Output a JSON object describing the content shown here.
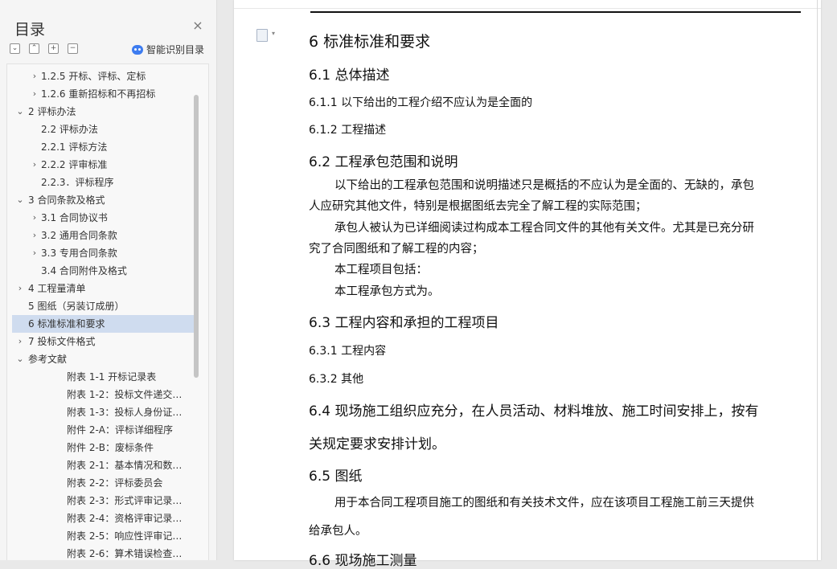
{
  "toc": {
    "title": "目录",
    "close_symbol": "×",
    "tools": [
      "⌄",
      "⌃",
      "+",
      "−"
    ],
    "ai_label": "智能识别目录",
    "items": [
      {
        "label": "1.2.5 开标、评标、定标",
        "chev": "›",
        "level": 1
      },
      {
        "label": "1.2.6 重新招标和不再招标",
        "chev": "›",
        "level": 1
      },
      {
        "label": "2 评标办法",
        "chev": "⌄",
        "level": 0
      },
      {
        "label": "2.2 评标办法",
        "chev": "",
        "level": 1
      },
      {
        "label": "2.2.1 评标方法",
        "chev": "",
        "level": 1
      },
      {
        "label": "2.2.2 评审标准",
        "chev": "›",
        "level": 1
      },
      {
        "label": "2.2.3．评标程序",
        "chev": "",
        "level": 1
      },
      {
        "label": "3 合同条款及格式",
        "chev": "⌄",
        "level": 0
      },
      {
        "label": "3.1  合同协议书",
        "chev": "›",
        "level": 1
      },
      {
        "label": "3.2  通用合同条款",
        "chev": "›",
        "level": 1
      },
      {
        "label": "3.3  专用合同条款",
        "chev": "›",
        "level": 1
      },
      {
        "label": "3.4  合同附件及格式",
        "chev": "",
        "level": 1
      },
      {
        "label": "4 工程量清单",
        "chev": "›",
        "level": 0
      },
      {
        "label": "5 图纸（另装订成册）",
        "chev": "",
        "level": 0
      },
      {
        "label": "6  标准标准和要求",
        "chev": "",
        "level": 0,
        "selected": true
      },
      {
        "label": "7 投标文件格式",
        "chev": "›",
        "level": 0
      },
      {
        "label": "参考文献",
        "chev": "⌄",
        "level": 0
      },
      {
        "label": "附表 1-1  开标记录表",
        "chev": "",
        "level": 2
      },
      {
        "label": "附表 1-2：投标文件递交…",
        "chev": "",
        "level": 2
      },
      {
        "label": "附表 1-3：投标人身份证…",
        "chev": "",
        "level": 2
      },
      {
        "label": "附件 2-A：评标详细程序",
        "chev": "",
        "level": 2
      },
      {
        "label": "附件 2-B：废标条件",
        "chev": "",
        "level": 2
      },
      {
        "label": "附表 2-1：基本情况和数…",
        "chev": "",
        "level": 2
      },
      {
        "label": "附表 2-2：评标委员会",
        "chev": "",
        "level": 2
      },
      {
        "label": "附表 2-3：形式评审记录…",
        "chev": "",
        "level": 2
      },
      {
        "label": "附表 2-4：资格评审记录…",
        "chev": "",
        "level": 2
      },
      {
        "label": "附表 2-5：响应性评审记…",
        "chev": "",
        "level": 2
      },
      {
        "label": "附表 2-6：算术错误检查…",
        "chev": "",
        "level": 2
      }
    ]
  },
  "doc": {
    "h_6": "6  标准标准和要求",
    "h_6_1": "6.1 总体描述",
    "h_6_1_1": "6.1.1 以下给出的工程介绍不应认为是全面的",
    "h_6_1_2": "6.1.2 工程描述",
    "h_6_2": "6.2 工程承包范围和说明",
    "p_1a": "以下给出的工程承包范围和说明描述只是概括的不应认为是全面的、无缺的，承包",
    "p_1b": "人应研究其他文件，特别是根据图纸去完全了解工程的实际范围；",
    "p_2a": "承包人被认为已详细阅读过构成本工程合同文件的其他有关文件。尤其是已充分研",
    "p_2b": "究了合同图纸和了解工程的内容；",
    "p_3": "本工程项目包括：",
    "p_4": "本工程承包方式为。",
    "h_6_3": "6.3 工程内容和承担的工程项目",
    "h_6_3_1": "6.3.1 工程内容",
    "h_6_3_2": "6.3.2 其他",
    "h_6_4a": "6.4 现场施工组织应充分，在人员活动、材料堆放、施工时间安排上，按有",
    "h_6_4b": "关规定要求安排计划。",
    "h_6_5": "6.5 图纸",
    "p_5a": "用于本合同工程项目施工的图纸和有关技术文件，应在该项目工程施工前三天提供",
    "p_5b": "给承包人。",
    "h_6_6": "6.6 现场施工测量"
  }
}
